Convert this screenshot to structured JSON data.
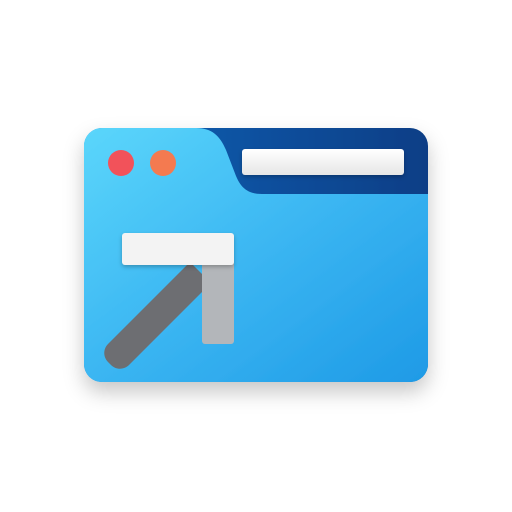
{
  "icon": {
    "name": "shortcut-window-icon",
    "depicts": [
      "window-frame",
      "title-bar-dots",
      "address-bar",
      "shortcut-arrow"
    ]
  },
  "colors": {
    "window_light": "#5bd6fb",
    "window_mid": "#3bb6f2",
    "window_dark": "#1e9ae6",
    "tab_dark": "#0a3e86",
    "tab_mid": "#0f63b8",
    "dot_red": "#f2525a",
    "dot_orange": "#f47a50",
    "address_bar": "#f2f2f2",
    "arrow_top": "#f3f3f3",
    "arrow_side": "#b3b6ba",
    "arrow_diag": "#6d6e72"
  }
}
